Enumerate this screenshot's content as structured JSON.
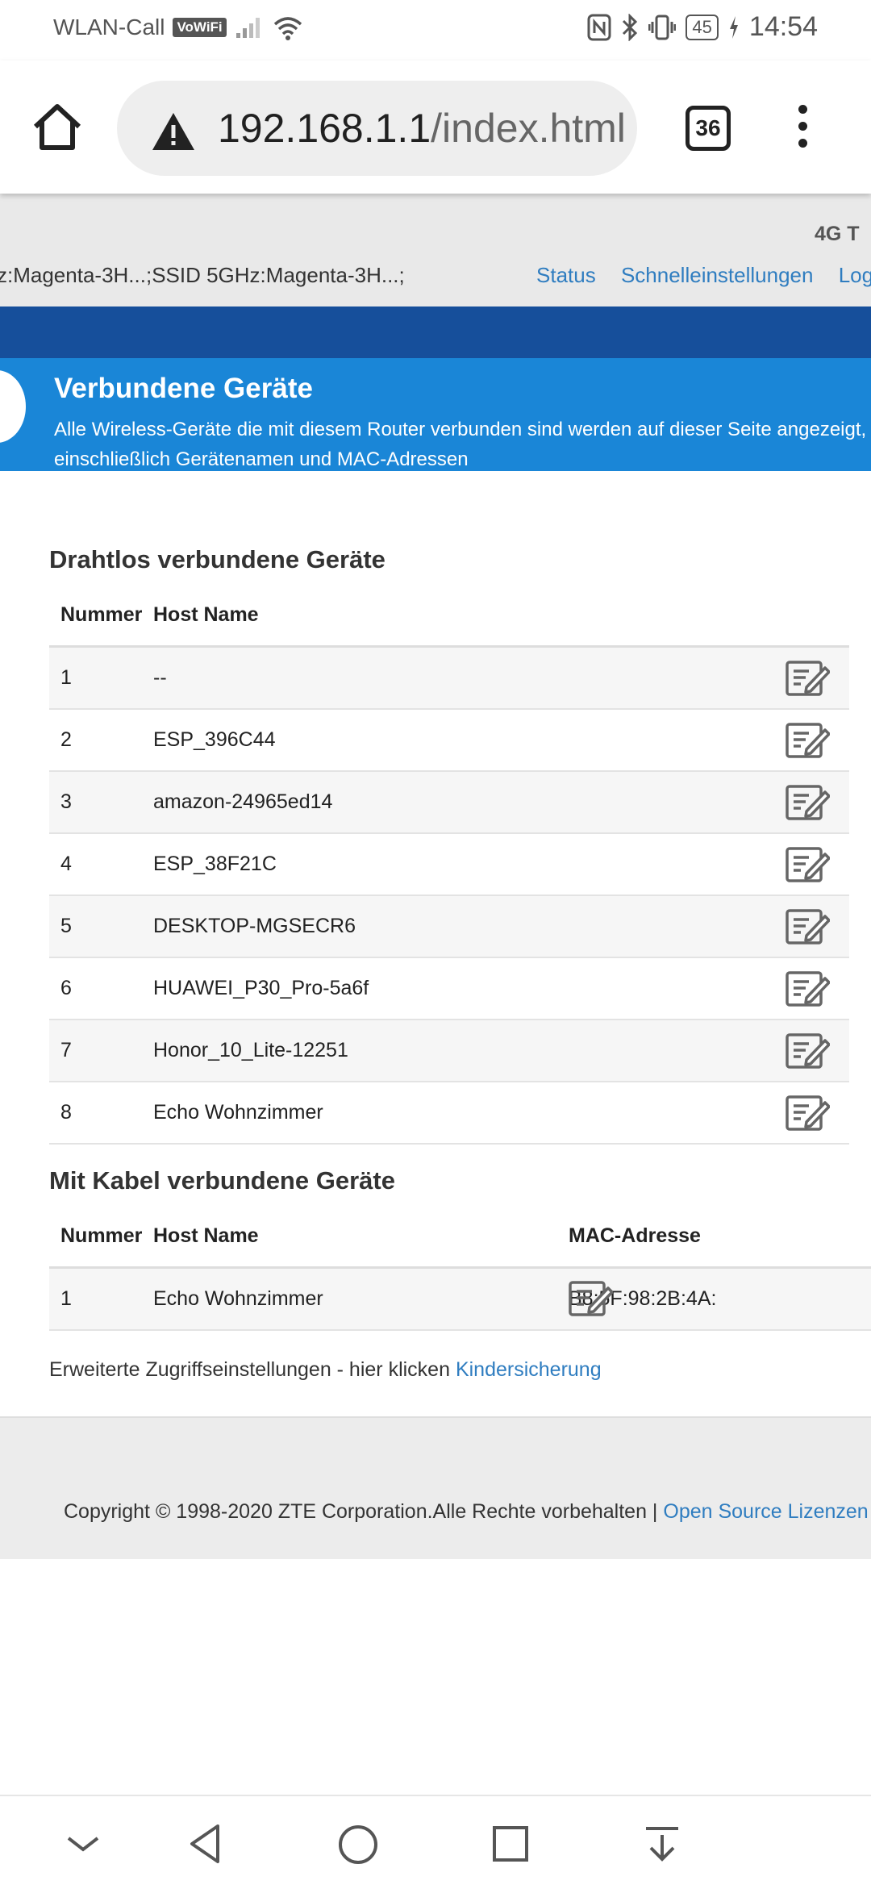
{
  "status_bar": {
    "carrier_text": "WLAN-Call",
    "vowifi_badge": "VoWiFi",
    "battery": "45",
    "time": "14:54"
  },
  "browser": {
    "url_host": "192.168.1.1",
    "url_path": "/index.html",
    "tab_count": "36"
  },
  "router": {
    "network_type": "4G  T",
    "ssid_text": "z:Magenta-3H...;SSID 5GHz:Magenta-3H...;",
    "links": {
      "status": "Status",
      "quick_settings": "Schnelleinstellungen",
      "login": "Login"
    }
  },
  "banner": {
    "title": "Verbundene Geräte",
    "description": "Alle Wireless-Geräte die mit diesem Router verbunden sind werden auf dieser Seite angezeigt, einschließlich Gerätenamen und MAC-Adressen"
  },
  "wireless": {
    "title": "Drahtlos verbundene Geräte",
    "headers": {
      "number": "Nummer",
      "host": "Host Name"
    },
    "rows": [
      {
        "num": "1",
        "host": "--"
      },
      {
        "num": "2",
        "host": "ESP_396C44"
      },
      {
        "num": "3",
        "host": "amazon-24965ed14"
      },
      {
        "num": "4",
        "host": "ESP_38F21C"
      },
      {
        "num": "5",
        "host": "DESKTOP-MGSECR6"
      },
      {
        "num": "6",
        "host": "HUAWEI_P30_Pro-5a6f"
      },
      {
        "num": "7",
        "host": "Honor_10_Lite-12251"
      },
      {
        "num": "8",
        "host": "Echo Wohnzimmer"
      }
    ]
  },
  "wired": {
    "title": "Mit Kabel verbundene Geräte",
    "headers": {
      "number": "Nummer",
      "host": "Host Name",
      "mac": "MAC-Adresse"
    },
    "rows": [
      {
        "num": "1",
        "host": "Echo Wohnzimmer",
        "mac": "B8:5F:98:2B:4A:"
      }
    ]
  },
  "access": {
    "text": "Erweiterte Zugriffseinstellungen - hier klicken ",
    "link": "Kindersicherung"
  },
  "footer": {
    "copyright": "Copyright © 1998-2020 ZTE Corporation.Alle Rechte vorbehalten  |  ",
    "link": "Open Source Lizenzen"
  },
  "colors": {
    "nav_blue": "#164f9b",
    "banner_blue": "#1a86d7",
    "link_blue": "#2f7dc0"
  }
}
